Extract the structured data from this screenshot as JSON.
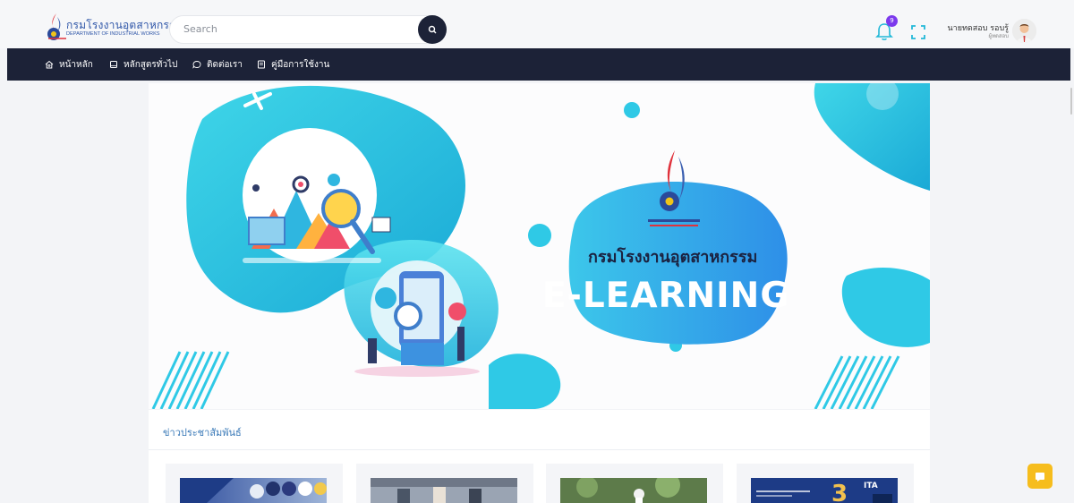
{
  "header": {
    "brand_th": "กรมโรงงานอุตสาหกรรม",
    "brand_en": "DEPARTMENT OF INDUSTRIAL WORKS",
    "search_placeholder": "Search",
    "notifications_count": "9",
    "user_name": "นายทดสอบ รอบรู้",
    "user_role": "ผู้ทดสอบ"
  },
  "nav": {
    "items": [
      {
        "label": "หน้าหลัก",
        "icon": "home-icon"
      },
      {
        "label": "หลักสูตรทั่วไป",
        "icon": "book-icon"
      },
      {
        "label": "ติดต่อเรา",
        "icon": "chat-icon"
      },
      {
        "label": "คู่มือการใช้งาน",
        "icon": "manual-icon"
      }
    ]
  },
  "banner": {
    "title_th": "กรมโรงงานอุตสาหกรรม",
    "title_en": "E-LEARNING"
  },
  "news": {
    "title": "ข่าวประชาสัมพันธ์",
    "card4_badge": "ITA"
  },
  "colors": {
    "nav_bg": "#1c2237",
    "accent_blue": "#2f56a8",
    "cyan": "#2ec5e6",
    "badge_purple": "#7c3aed",
    "float_yellow": "#f6bd1d"
  }
}
